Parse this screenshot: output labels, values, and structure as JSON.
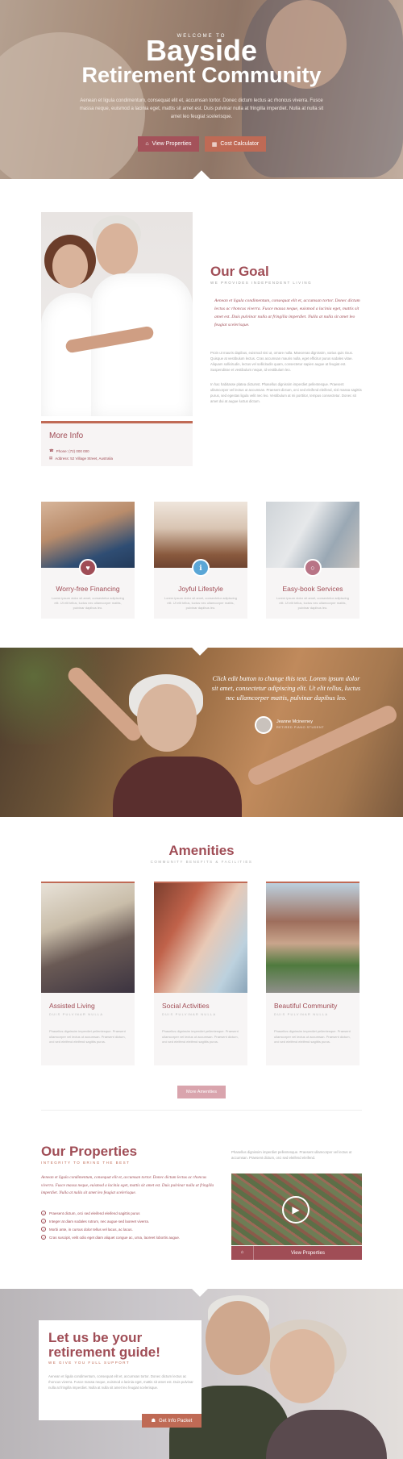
{
  "hero": {
    "eyebrow": "WELCOME TO",
    "title_line1": "Bayside",
    "title_line2": "Retirement Community",
    "intro": "Aenean et ligula condimentum, consequat elit et, accumsan tortor. Donec dictum lectus ac rhoncus viverra. Fusce massa neque, euismod a lacinia eget, mattis sit amet est. Duis pulvinar nulla at fringilla imperdiet. Nulla at nulla sit amet leo feugiat scelerisque.",
    "btn_view": "View Properties",
    "btn_calc": "Cost Calculator"
  },
  "goal": {
    "title": "Our Goal",
    "subtitle": "WE PROVIDES INDEPENDENT LIVING",
    "quote": "Aenean et ligula condimentum, consequat elit et, accumsan tortor. Donec dictum lectus ac rhoncus viverra. Fusce massa neque, euismod a lacinia eget, mattis sit amet est. Duis pulvinar nulla at fringilla imperdiet. Nulla at nulla sit amet leo feugiat scelerisque.",
    "para1": "Proin ut mauris dapibus, euismod nisi ut, ornare nulla. Maecenas dignissim, varius quis risus. Quisque at vestibulum lectus. Cras accumsan mauris nulla, eget efficitur purus sodales vitae. Aliquam sollicitudin, lectus vel sollicitudin quam, consectetur sapien augue at feugiat est. Suspendisse et vestibulum neque, id vestibulum leo.",
    "para2": "In hac habitasse platea dictumst. Phasellus dignissim imperdiet pellentesque. Praesent ullamcorper vel lectus ut accumsan. Praesent dictum, orci sed eleifend eleifend, nisl massa sagittis purus, sed egestas ligula velit nec leo. Vestibulum at mi porttitor, tempus consectetur. Donec sit amet dui at augue luctus dictum.",
    "info_title": "More Info",
    "phone": "Phone: (72) 000 000",
    "address": "Address: 52 Village Street, Australia"
  },
  "features": [
    {
      "title": "Worry-free Financing",
      "text": "Lorem ipsum dolor sit amet, consectetur adipiscing elit. Ut elit tellus, luctus nec ullamcorper mattis, pulvinar dapibus leo.",
      "icon": "heart-icon",
      "color": "#a04d56"
    },
    {
      "title": "Joyful Lifestyle",
      "text": "Lorem ipsum dolor sit amet, consectetur adipiscing elit. Ut elit tellus, luctus nec ullamcorper mattis, pulvinar dapibus leo.",
      "icon": "info-icon",
      "color": "#5aa6d6"
    },
    {
      "title": "Easy-book Services",
      "text": "Lorem ipsum dolor sit amet, consectetur adipiscing elit. Ut elit tellus, luctus nec ullamcorper mattis, pulvinar dapibus leo.",
      "icon": "circle-icon",
      "color": "#b87486"
    }
  ],
  "testimonial": {
    "quote": "Click edit button to change this text. Lorem ipsum dolor sit amet, consectetur adipiscing elit. Ut elit tellus, luctus nec ullamcorper mattis, pulvinar dapibus leo.",
    "name": "Jeanne Mcinerney",
    "role": "RETIRED PIANO STUDENT"
  },
  "amenities": {
    "title": "Amenities",
    "subtitle": "COMMUNITY BENEFITS & FACILITIES",
    "items": [
      {
        "title": "Assisted Living",
        "sub": "DUIS PULVINAR NULLA",
        "text": "Phasellus dignissim imperdiet pellentesque. Praesent ullamcorper vel lectus ut accumsan. Praesent dictum, orci sed eleifend eleifend sagittis purus."
      },
      {
        "title": "Social Activities",
        "sub": "DUIS PULVINAR NULLA",
        "text": "Phasellus dignissim imperdiet pellentesque. Praesent ullamcorper vel lectus ut accumsan. Praesent dictum, orci sed eleifend eleifend sagittis purus."
      },
      {
        "title": "Beautiful Community",
        "sub": "DUIS PULVINAR NULLA",
        "text": "Phasellus dignissim imperdiet pellentesque. Praesent ullamcorper vel lectus ut accumsan. Praesent dictum, orci sed eleifend eleifend sagittis purus."
      }
    ],
    "more_btn": "More Amenities"
  },
  "properties": {
    "title": "Our Properties",
    "subtitle": "INTEGRITY TO BRING THE BEST",
    "text": "Aenean et ligula condimentum, consequat elit et, accumsan tortor. Donec dictum lectus ac rhoncus viverra. Fusce massa neque, euismod a lacinia eget, mattis sit amet est. Duis pulvinar nulla at fringilla imperdiet. Nulla at nulla sit amet leo feugiat scelerisque.",
    "list": [
      "Praesent dictum, orci sed eleifend eleifend sagittis purus",
      "Integer at diam sodales rutrum, nec augue sed laoreet viverra.",
      "Morbi ante, in cursus dolor tellus vel lacus, ac lacus.",
      "Cras suscipit, velit odio eget diam aliquet congue ac, urna, laoreet lobortis augue."
    ],
    "right_text": "Phasellus dignissim imperdiet pellentesque. Praesent ullamcorper vel lectus ut accumsan. Praesent dictum, orci sed eleifend eleifend.",
    "btn": "View Properties"
  },
  "guide": {
    "title": "Let us be your retirement guide!",
    "subtitle": "WE GIVE YOU FULL SUPPORT",
    "text": "Aenean et ligula condimentum, consequat elit et, accumsan tortor. Donec dictum lectus ac rhoncus viverra. Fusce massa neque, euismod a lacinia eget, mattis sit amet est. Duis pulvinar nulla at fringilla imperdiet. Nulla at nulla sit amet leo feugiat scelerisque.",
    "btn": "Get Info Packet"
  },
  "colors": {
    "primary": "#a04d56",
    "accent": "#bf6a55",
    "link_blue": "#5aa6d6"
  }
}
